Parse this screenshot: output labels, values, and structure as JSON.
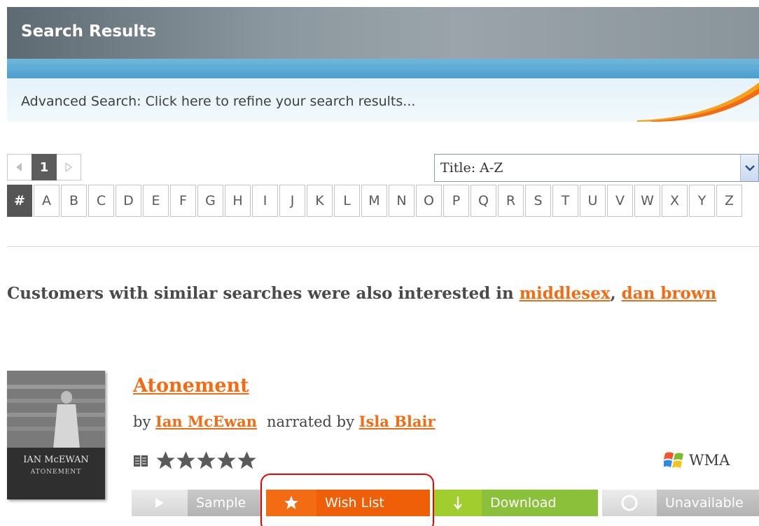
{
  "header": {
    "title": "Search Results"
  },
  "advanced_search": {
    "text": "Advanced Search: Click here to refine your search results..."
  },
  "pager": {
    "current_page": "1"
  },
  "sort": {
    "selected": "Title: A-Z"
  },
  "letters": [
    "#",
    "A",
    "B",
    "C",
    "D",
    "E",
    "F",
    "G",
    "H",
    "I",
    "J",
    "K",
    "L",
    "M",
    "N",
    "O",
    "P",
    "Q",
    "R",
    "S",
    "T",
    "U",
    "V",
    "W",
    "X",
    "Y",
    "Z"
  ],
  "suggestions": {
    "prefix": "Customers with similar searches were also interested in ",
    "links": [
      "middlesex",
      "dan brown"
    ],
    "separator": ", "
  },
  "result": {
    "title": "Atonement",
    "by_label": "by",
    "author": "Ian McEwan",
    "narrated_label": "narrated by",
    "narrator": "Isla Blair",
    "rating_stars": 5,
    "format": "WMA",
    "cover": {
      "author_text": "IAN McEWAN",
      "title_text": "ATONEMENT"
    },
    "buttons": {
      "sample": "Sample",
      "wish_list": "Wish List",
      "download": "Download",
      "unavailable": "Unavailable"
    }
  },
  "colors": {
    "accent_orange": "#f36b12",
    "download_green": "#8bc13a",
    "highlight_red": "#e00000"
  }
}
